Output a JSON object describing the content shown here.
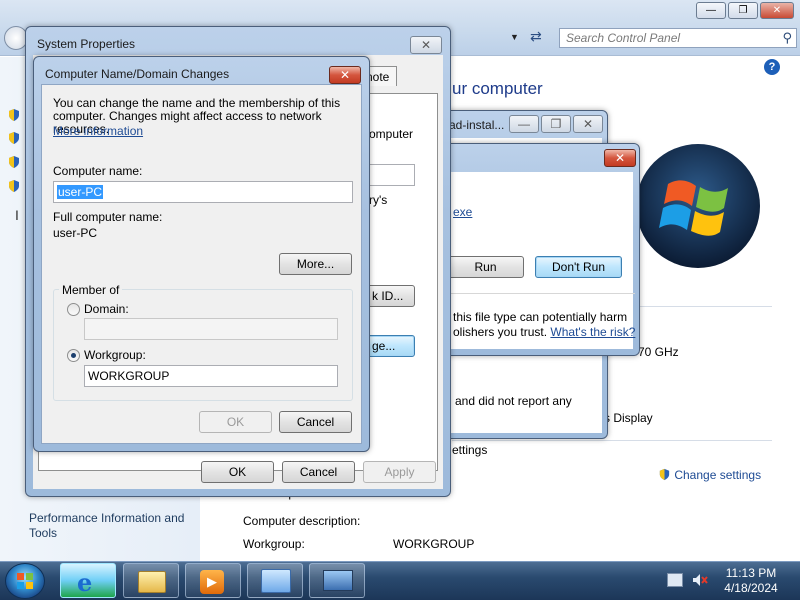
{
  "control_panel": {
    "search_placeholder": "Search Control Panel",
    "help_label": "?",
    "heading": "ur computer",
    "left_links": [
      "Performance Information and Tools"
    ],
    "partial_texts": {
      "ghz": "70 GHz",
      "display": "s Display",
      "settings": "ettings",
      "full_computer_name_label": "Full computer name:",
      "full_computer_name_value": "user-PC",
      "computer_description_label": "Computer description:",
      "workgroup_label": "Workgroup:",
      "workgroup_value": "WORKGROUP"
    },
    "change_settings_link": "Change settings"
  },
  "installer_window": {
    "title": "ad-instal...",
    "body_text": "and did not report any"
  },
  "security_dialog": {
    "link_fragment": "exe",
    "run_label": "Run",
    "dont_run_label": "Don't Run",
    "warning_line1": "this file type can potentially harm",
    "warning_line2": "olishers you trust.",
    "risk_link": "What's the risk?"
  },
  "system_properties": {
    "title": "System Properties",
    "tab_partial": "note",
    "partial_texts": {
      "computer": "omputer",
      "rys": "ry's",
      "network_id_button": "k ID...",
      "change_button": "ge..."
    },
    "ok_label": "OK",
    "cancel_label": "Cancel",
    "apply_label": "Apply"
  },
  "computer_name_dialog": {
    "title": "Computer Name/Domain Changes",
    "description": "You can change the name and the membership of this computer. Changes might affect access to network resources.",
    "more_info_link": "More information",
    "computer_name_label": "Computer name:",
    "computer_name_value": "user-PC",
    "full_name_label": "Full computer name:",
    "full_name_value": "user-PC",
    "more_button": "More...",
    "member_of_label": "Member of",
    "domain_label": "Domain:",
    "domain_value": "",
    "workgroup_label": "Workgroup:",
    "workgroup_value": "WORKGROUP",
    "selected_membership": "workgroup",
    "ok_label": "OK",
    "cancel_label": "Cancel"
  },
  "taskbar": {
    "items": [
      "internet-explorer",
      "windows-explorer",
      "media-player",
      "control-panel",
      "remote-desktop"
    ],
    "time": "11:13 PM",
    "date": "4/18/2024"
  },
  "colors": {
    "link": "#1e4b94",
    "title_bar": "#a6c0df",
    "selection": "#3399ff"
  }
}
